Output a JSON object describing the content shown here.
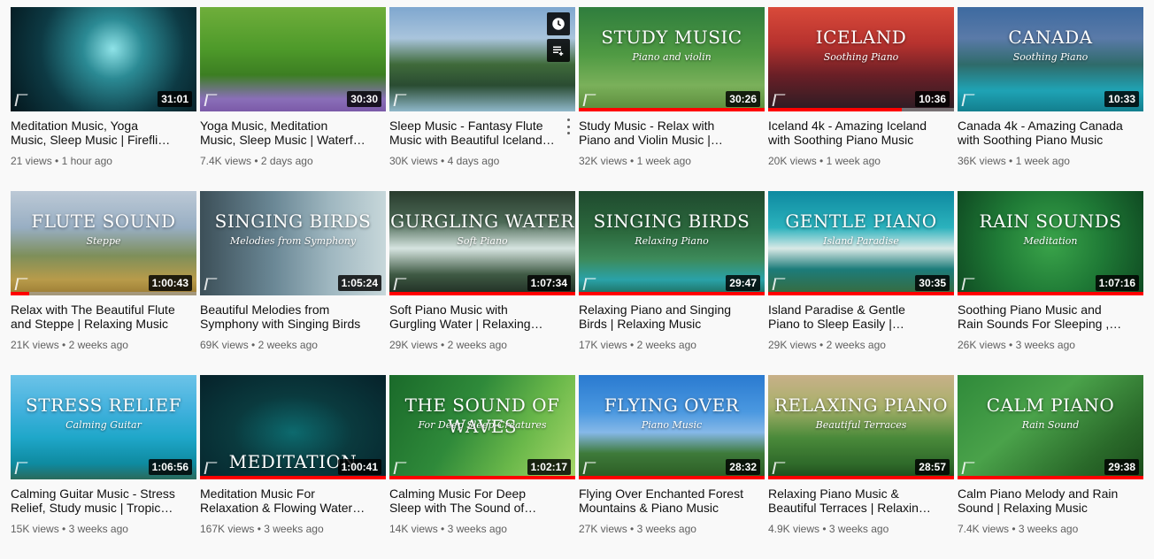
{
  "videos": [
    {
      "title": "Meditation Music, Yoga Music, Sleep Music | Fireflies Forest Night",
      "views": "21 views",
      "age": "1 hour ago",
      "duration": "31:01",
      "art_title": "",
      "art_sub": "",
      "bg": "radial-gradient(circle at 55% 40%, #8fe3e8 0%, #2b8a94 25%, #0d3a44 60%, #04161c 100%)",
      "progress": 0
    },
    {
      "title": "Yoga Music, Meditation Music, Sleep Music | Waterfall Valley",
      "views": "7.4K views",
      "age": "2 days ago",
      "duration": "30:30",
      "art_title": "",
      "art_sub": "",
      "bg": "linear-gradient(180deg, #6fae3b 0%, #4e9a2a 40%, #3c7e22 65%, #8a6fb8 88%, #7b5aa8 100%)",
      "progress": 0
    },
    {
      "title": "Sleep Music - Fantasy Flute Music with Beautiful Iceland Scenery",
      "views": "30K views",
      "age": "4 days ago",
      "duration": "",
      "art_title": "",
      "art_sub": "",
      "bg": "linear-gradient(180deg, #7fa7cf 0%, #a9c4dc 30%, #3f6a3a 55%, #2a4c32 75%, #8fb7c9 100%)",
      "progress": 0,
      "hover": true
    },
    {
      "title": "Study Music - Relax with Piano and Violin Music | Butterfly Garden",
      "views": "32K views",
      "age": "1 week ago",
      "duration": "30:26",
      "art_title": "STUDY MUSIC",
      "art_sub": "Piano and violin",
      "bg": "linear-gradient(180deg, #2f7d3d 0%, #4f9a43 45%, #7ab05a 75%, #5a8a3a 100%)",
      "progress": 100
    },
    {
      "title": "Iceland 4k - Amazing Iceland with Soothing Piano Music",
      "views": "20K views",
      "age": "1 week ago",
      "duration": "10:36",
      "art_title": "ICELAND",
      "art_sub": "Soothing Piano",
      "bg": "linear-gradient(180deg, #d94a3a 0%, #b7322e 35%, #6a1f26 65%, #2a1c24 100%)",
      "progress": 72
    },
    {
      "title": "Canada 4k - Amazing Canada with Soothing Piano Music",
      "views": "36K views",
      "age": "1 week ago",
      "duration": "10:33",
      "art_title": "CANADA",
      "art_sub": "Soothing Piano",
      "bg": "linear-gradient(180deg, #3d6aa0 0%, #5a7aa8 30%, #2f6b6a 55%, #1fa3b5 80%, #137f8e 100%)",
      "progress": 0
    },
    {
      "title": "Relax with The Beautiful Flute and Steppe | Relaxing Music",
      "views": "21K views",
      "age": "2 weeks ago",
      "duration": "1:00:43",
      "art_title": "FLUTE SOUND",
      "art_sub": "Steppe",
      "bg": "linear-gradient(180deg, #bcc9d6 0%, #98aec3 35%, #7e8f5a 62%, #b89b4a 85%, #9a7a32 100%)",
      "progress": 10
    },
    {
      "title": "Beautiful Melodies from Symphony with Singing Birds",
      "views": "69K views",
      "age": "2 weeks ago",
      "duration": "1:05:24",
      "art_title": "SINGING BIRDS",
      "art_sub": "Melodies from Symphony",
      "bg": "linear-gradient(90deg, #3c4f58 0%, #6b8896 40%, #9fb7c0 70%, #c7d7da 100%)",
      "progress": 0
    },
    {
      "title": "Soft Piano Music with Gurgling Water | Relaxing Music",
      "views": "29K views",
      "age": "2 weeks ago",
      "duration": "1:07:34",
      "art_title": "GURGLING WATER",
      "art_sub": "Soft Piano",
      "bg": "linear-gradient(180deg, #2a3c2e 0%, #4c6a56 30%, #d6e4e0 55%, #3f5a44 80%, #1e2c22 100%)",
      "progress": 100
    },
    {
      "title": "Relaxing Piano and Singing Birds | Relaxing Music",
      "views": "17K views",
      "age": "2 weeks ago",
      "duration": "29:47",
      "art_title": "SINGING BIRDS",
      "art_sub": "Relaxing Piano",
      "bg": "linear-gradient(180deg, #1f4a2e 0%, #2c6a3e 40%, #3d8a5a 65%, #2aa2a8 85%, #1c6a5a 100%)",
      "progress": 100
    },
    {
      "title": "Island Paradise & Gentle Piano to Sleep Easily | Relaxing Music",
      "views": "29K views",
      "age": "2 weeks ago",
      "duration": "30:35",
      "art_title": "GENTLE PIANO",
      "art_sub": "Island Paradise",
      "bg": "linear-gradient(180deg, #0e8aa0 0%, #2bb2bd 35%, #d9e9e6 55%, #1c7c7a 75%, #3a6a3a 100%)",
      "progress": 100
    },
    {
      "title": "Soothing Piano Music and Rain Sounds For Sleeping , Meditation",
      "views": "26K views",
      "age": "3 weeks ago",
      "duration": "1:07:16",
      "art_title": "RAIN SOUNDS",
      "art_sub": "Meditation",
      "bg": "radial-gradient(circle at 50% 50%, #3aa44a 0%, #1f7a36 50%, #0f4a22 100%)",
      "progress": 100
    },
    {
      "title": "Calming Guitar Music - Stress Relief, Study music | Tropical Sea",
      "views": "15K views",
      "age": "3 weeks ago",
      "duration": "1:06:56",
      "art_title": "STRESS RELIEF",
      "art_sub": "Calming Guitar",
      "bg": "linear-gradient(180deg, #6cc3e8 0%, #3fb0dc 35%, #1fa7c9 60%, #0e8aa0 85%, #2a6a5a 100%)",
      "progress": 0
    },
    {
      "title": "Meditation Music For Relaxation & Flowing Water | Spiritual",
      "views": "167K views",
      "age": "3 weeks ago",
      "duration": "1:00:41",
      "art_title": "",
      "art_sub": "",
      "bg": "radial-gradient(ellipse at 50% 55%, #0d6a6e 0%, #0a3a3e 45%, #06222a 100%)",
      "progress": 100,
      "bottom_art": "MEDITATION"
    },
    {
      "title": "Calming Music For Deep Sleep with The Sound of Waves",
      "views": "14K views",
      "age": "3 weeks ago",
      "duration": "1:02:17",
      "art_title": "THE SOUND OF WAVES",
      "art_sub": "For Deep Sleep Creatures",
      "bg": "linear-gradient(120deg, #1a6a2a 0%, #2f8a3a 40%, #6ab84a 70%, #a8d86a 100%)",
      "progress": 100
    },
    {
      "title": "Flying Over Enchanted Forest Mountains & Piano Music",
      "views": "27K views",
      "age": "3 weeks ago",
      "duration": "28:32",
      "art_title": "FLYING OVER",
      "art_sub": "Piano Music",
      "bg": "linear-gradient(180deg, #2a7ad0 0%, #4a98e0 35%, #86b8e8 55%, #3e7a3a 75%, #2a5a22 100%)",
      "progress": 100
    },
    {
      "title": "Relaxing Piano Music & Beautiful Terraces | Relaxing Music",
      "views": "4.9K views",
      "age": "3 weeks ago",
      "duration": "28:57",
      "art_title": "RELAXING PIANO",
      "art_sub": "Beautiful Terraces",
      "bg": "linear-gradient(180deg, #c8b089 0%, #a8b06a 30%, #4a8a3a 60%, #2f6a2a 85%, #1e4a1a 100%)",
      "progress": 100
    },
    {
      "title": "Calm Piano Melody and Rain Sound | Relaxing Music",
      "views": "7.4K views",
      "age": "3 weeks ago",
      "duration": "29:38",
      "art_title": "CALM PIANO",
      "art_sub": "Rain Sound",
      "bg": "linear-gradient(140deg, #2f8a3a 0%, #4aa24a 40%, #2a6a2a 75%, #1a4a1a 100%)",
      "progress": 100
    }
  ],
  "icons": {
    "watch_later": "clock-icon",
    "add_to_queue": "queue-icon",
    "more": "more-vert-icon"
  }
}
